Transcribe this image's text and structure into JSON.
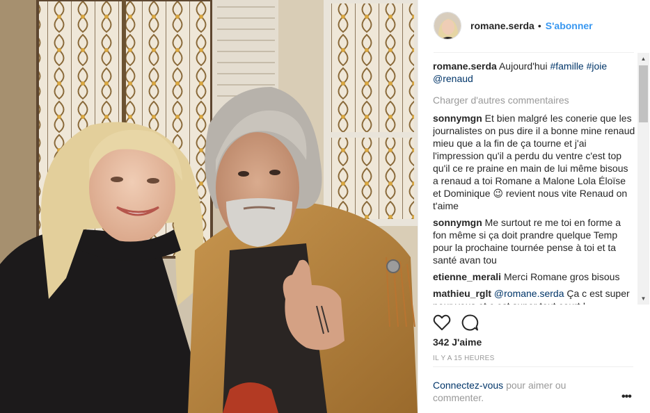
{
  "header": {
    "username": "romane.serda",
    "separator": "•",
    "follow_label": "S'abonner"
  },
  "caption": {
    "username": "romane.serda",
    "text": "Aujourd'hui",
    "hashtag_1": "#famille",
    "hashtag_2": "#joie",
    "mention": "@renaud"
  },
  "load_more_label": "Charger d'autres commentaires",
  "comments": [
    {
      "username": "sonnymgn",
      "text": "Et bien malgré les conerie que les journalistes on pus dire il a bonne mine renaud mieu que a la fin de ça tourne et j'ai l'impression qu'il a perdu du ventre c'est top qu'il ce re praine en main de lui même bisous a renaud a toi Romane a Malone Lola Éloïse et Dominique 😉 revient nous vite Renaud on t'aime"
    },
    {
      "username": "sonnymgn",
      "text": "Me surtout re me toi en forme a fon même si ça doit prandre quelque Temp pour la prochaine tournée pense à toi et ta santé avan tou"
    },
    {
      "username": "etienne_merali",
      "text": "Merci Romane gros bisous"
    },
    {
      "username": "mathieu_rglt",
      "mention": "@romane.serda",
      "text": "Ça c est super pour vous et c est super tout court !"
    }
  ],
  "likes_label": "342 J'aime",
  "timestamp": "IL Y A 15 HEURES",
  "login": {
    "link": "Connectez-vous",
    "text": "pour aimer ou commenter."
  },
  "more_options_label": "•••",
  "icons": {
    "like": "heart-icon",
    "comment": "comment-icon",
    "scroll_up": "scroll-up-arrow-icon",
    "scroll_down": "scroll-down-arrow-icon"
  },
  "colors": {
    "link_blue": "#3897f0",
    "hashtag_blue": "#003569",
    "muted_gray": "#999999",
    "text_dark": "#262626"
  }
}
